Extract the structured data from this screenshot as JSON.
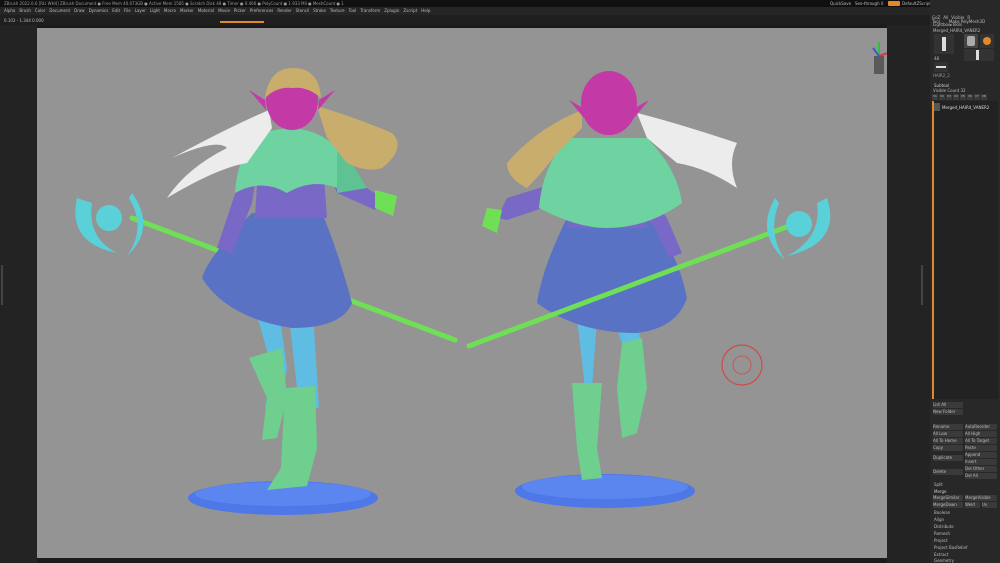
{
  "window": {
    "title": "ZBrush 2022.0.6 [RLI WH4]    ZBrush Document    ● Free Mem 40.073GB ● Active Mem 1585 ● Scratch Disk 48 ● Timer ● 0.466 ● PolyCount ● 1.933 Mil ● MeshCount ● 1",
    "quicksave": "QuickSave",
    "seethrough": "See-through 0",
    "menus": "Menus",
    "default_script": "DefaultZScript"
  },
  "menubar": {
    "items": [
      "Alpha",
      "Brush",
      "Color",
      "Document",
      "Draw",
      "Dynamics",
      "Edit",
      "File",
      "Layer",
      "Light",
      "Macro",
      "Marker",
      "Material",
      "Movie",
      "Picker",
      "Preferences",
      "Render",
      "Stencil",
      "Stroke",
      "Texture",
      "Tool",
      "Transform",
      "Zplugin",
      "Zscript",
      "Help"
    ]
  },
  "infobar": {
    "text": "0.103 - 1.344 0.000"
  },
  "tool_panel": {
    "header_items": [
      "Tool",
      "Make PolyMesh3D"
    ],
    "row2": [
      "GoZ",
      "All",
      "Visible",
      "R"
    ],
    "lightbox": "Lightbox▸Tools",
    "subtool_name": "Merged_HAIR4_VANER2",
    "thumbs": [
      "Merged_HAIR4",
      "Cylinder PolyMesh3D",
      "SimpleBrush",
      "Merged_Merged"
    ],
    "count_label": "48",
    "extra_thumb": "HAIR2_2"
  },
  "subtool_panel": {
    "title": "Subtool",
    "visible_count": "Visible Count 32",
    "item": "Merged_HAIR4_VANER2",
    "list_tabs": [
      "V1",
      "V2",
      "V3",
      "V4",
      "V5",
      "V6",
      "V7",
      "V8"
    ]
  },
  "subtool_buttons": {
    "list_all": "List All",
    "new_folder": "New Folder",
    "rename": "Rename",
    "autoreorder": "AutoReorder",
    "all_low": "All Low",
    "all_high": "All High",
    "copy": "Copy",
    "paste": "Paste",
    "append": "Append",
    "insert": "Insert",
    "duplicate": "Duplicate",
    "delete": "Delete",
    "del_other": "Del Other",
    "del_all": "Del All",
    "split": "Split",
    "merge": "Merge",
    "merge_down": "MergeDown",
    "merge_similar": "MergeSimilar",
    "merge_visible": "MergeVisible",
    "weld": "Weld",
    "uv": "Uv",
    "boolean": "Boolean",
    "remesh": "Remesh",
    "project": "Project",
    "extract": "Extract",
    "geometry": "Geometry",
    "project_bas": "Project BasRelief",
    "align": "Align",
    "distribute": "Distribute",
    "all_to_home": "All To Home",
    "all_to_target": "All To Target"
  },
  "colors": {
    "viewport_bg": "#949494",
    "ui_dark": "#282828",
    "accent_orange": "#e08a2a",
    "skin_pink": "#c33aa6",
    "hair_blonde": "#c8ad6c",
    "hair_white": "#ececec",
    "cape_mint": "#6fd3a1",
    "jacket_purple": "#7a68c6",
    "skirt_blue": "#5a72c4",
    "leggings_cyan": "#5fbde3",
    "boots_green": "#6fcf8e",
    "staff_green": "#6fe056",
    "staff_head_cyan": "#5ad0d8",
    "base_blue": "#4e78e8"
  }
}
